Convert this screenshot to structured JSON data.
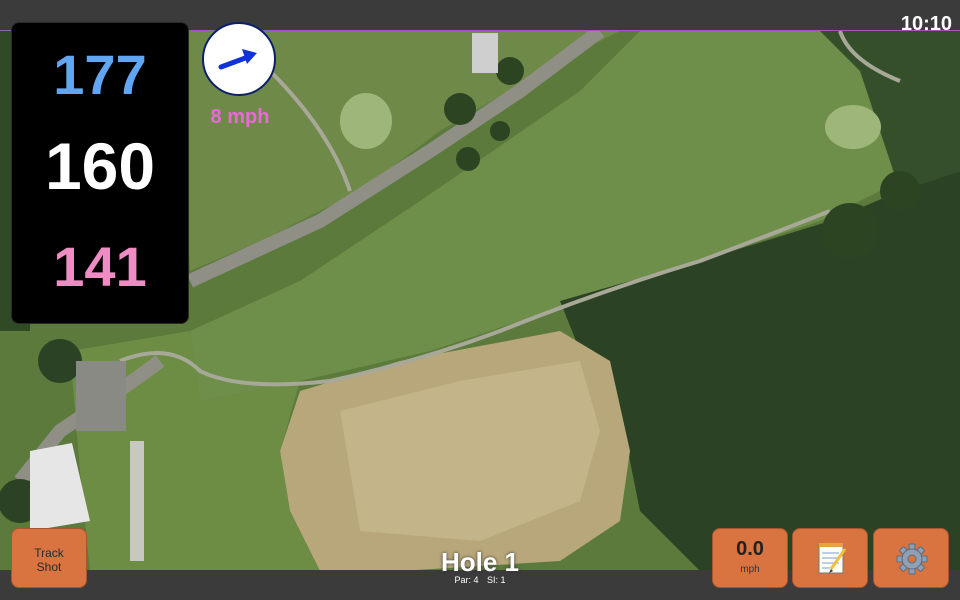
{
  "status": {
    "time": "10:10"
  },
  "yardage": {
    "back": "177",
    "middle": "160",
    "front": "141",
    "back_color": "#61a6f2",
    "front_color": "#f08cc4"
  },
  "wind": {
    "speed": "8 mph",
    "direction_icon": "arrow-icon",
    "arrow_color": "#1032d8",
    "label_color": "#e86ad6"
  },
  "buttons": {
    "track_shot": {
      "line1": "Track",
      "line2": "Shot"
    },
    "speed": {
      "value": "0.0",
      "unit": "mph"
    },
    "notes_icon": "notepad-icon",
    "settings_icon": "gear-icon"
  },
  "hole": {
    "title": "Hole 1",
    "par": "Par: 4",
    "si": "SI: 1"
  },
  "colors": {
    "button": "#d97440",
    "bar": "#3b3b3b"
  }
}
